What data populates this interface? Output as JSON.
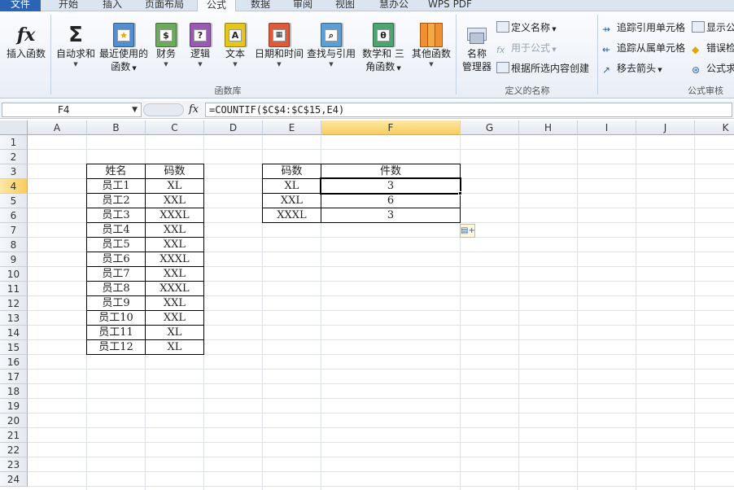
{
  "tabs": [
    "文件",
    "开始",
    "插入",
    "页面布局",
    "公式",
    "数据",
    "审阅",
    "视图",
    "慧办公",
    "WPS PDF"
  ],
  "active_tab": "公式",
  "ribbon": {
    "insert_function": "插入函数",
    "autosum": "自动求和",
    "recent": "最近使用的",
    "recent_line2": "函数",
    "financial": "财务",
    "logical": "逻辑",
    "text": "文本",
    "datetime": "日期和时间",
    "lookup": "查找与引用",
    "math": "数学和",
    "math_line2": "三角函数",
    "more": "其他函数",
    "group_library": "函数库",
    "name_manager": "名称",
    "name_manager_line2": "管理器",
    "define_name": "定义名称",
    "use_in_formula": "用于公式",
    "create_from_selection": "根据所选内容创建",
    "group_names": "定义的名称",
    "trace_precedents": "追踪引用单元格",
    "trace_dependents": "追踪从属单元格",
    "remove_arrows": "移去箭头",
    "show_formulas": "显示公",
    "error_checking": "错误检",
    "evaluate_formula": "公式求",
    "group_audit": "公式审核"
  },
  "formula_bar": {
    "name_box": "F4",
    "fx": "fx",
    "formula": "=COUNTIF($C$4:$C$15,E4)"
  },
  "sheet": {
    "columns": [
      "A",
      "B",
      "C",
      "D",
      "E",
      "F",
      "G",
      "H",
      "I",
      "J",
      "K"
    ],
    "rows": [
      "1",
      "2",
      "3",
      "4",
      "5",
      "6",
      "7",
      "8",
      "9",
      "10",
      "11",
      "12",
      "13",
      "14",
      "15",
      "16",
      "17",
      "18",
      "19",
      "20",
      "21",
      "22",
      "23",
      "24"
    ],
    "selected_cell": "F4",
    "table1": {
      "header": [
        "姓名",
        "码数"
      ],
      "rows": [
        [
          "员工1",
          "XL"
        ],
        [
          "员工2",
          "XXL"
        ],
        [
          "员工3",
          "XXXL"
        ],
        [
          "员工4",
          "XXL"
        ],
        [
          "员工5",
          "XXL"
        ],
        [
          "员工6",
          "XXXL"
        ],
        [
          "员工7",
          "XXL"
        ],
        [
          "员工8",
          "XXXL"
        ],
        [
          "员工9",
          "XXL"
        ],
        [
          "员工10",
          "XXL"
        ],
        [
          "员工11",
          "XL"
        ],
        [
          "员工12",
          "XL"
        ]
      ]
    },
    "table2": {
      "header": [
        "码数",
        "件数"
      ],
      "rows": [
        [
          "XL",
          "3"
        ],
        [
          "XXL",
          "6"
        ],
        [
          "XXXL",
          "3"
        ]
      ]
    }
  }
}
